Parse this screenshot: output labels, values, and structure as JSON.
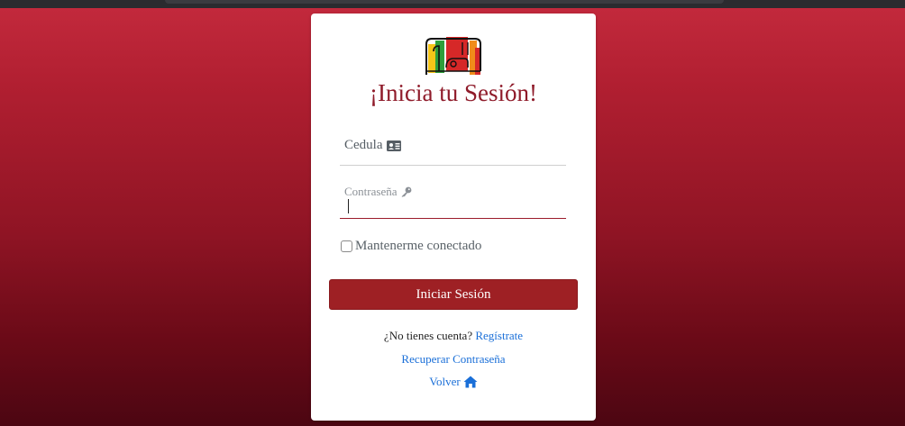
{
  "header": {
    "title": "¡Inicia tu Sesión!"
  },
  "logo": {
    "icon": "bookshelf-logo-icon",
    "colors": [
      "#f5c518",
      "#2e9e3a",
      "#d62828",
      "#f08c1a"
    ]
  },
  "form": {
    "cedula_label": "Cedula",
    "cedula_icon": "id-card-icon",
    "password_label": "Contraseña",
    "password_icon": "key-icon",
    "remember_label": "Mantenerme conectado",
    "remember_checked": false,
    "submit_label": "Iniciar Sesión"
  },
  "links": {
    "no_account_text": "¿No tienes cuenta?",
    "register_label": "Regístrate",
    "recover_label": "Recuperar Contraseña",
    "back_label": "Volver",
    "back_icon": "home-icon"
  },
  "colors": {
    "accent": "#9e2024",
    "title": "#8f1b2a",
    "link": "#1a6fd8"
  }
}
